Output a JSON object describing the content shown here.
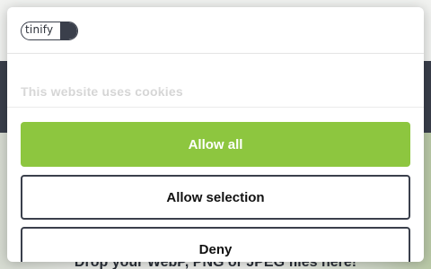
{
  "background": {
    "drop_text": "Drop your WebP, PNG or JPEG files here!"
  },
  "consent": {
    "logo_text": "tinify",
    "title": "This website uses cookies",
    "buttons": {
      "allow_all": "Allow all",
      "allow_selection": "Allow selection",
      "deny": "Deny"
    }
  },
  "colors": {
    "accent_green": "#8dc63f",
    "dark": "#3a3f4b",
    "title_gray": "#b8b8b8"
  }
}
